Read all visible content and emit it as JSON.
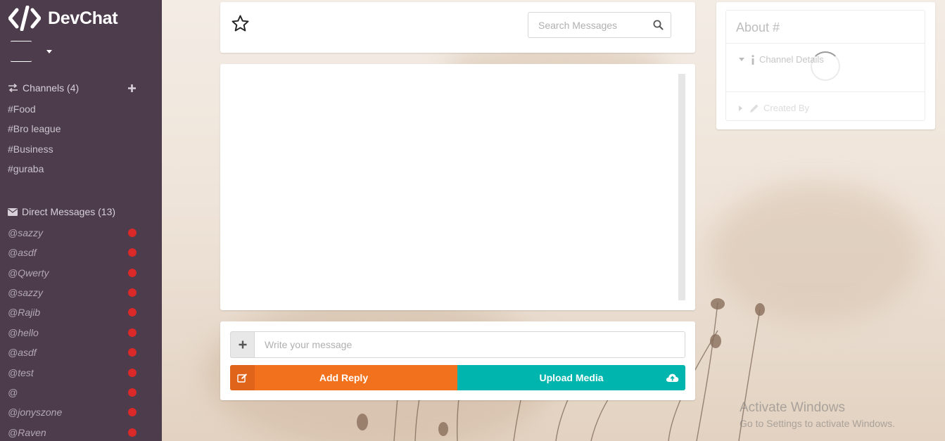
{
  "app": {
    "name": "DevChat"
  },
  "channels": {
    "header": "Channels (4)",
    "items": [
      "#Food",
      "#Bro league",
      "#Business",
      "#guraba"
    ]
  },
  "direct_messages": {
    "header": "Direct Messages (13)",
    "items": [
      "@sazzy",
      "@asdf",
      "@Qwerty",
      "@sazzy",
      "@Rajib",
      "@hello",
      "@asdf",
      "@test",
      "@",
      "@jonyszone",
      "@Raven"
    ],
    "status_color": "#db2828"
  },
  "message_header": {
    "search_placeholder": "Search Messages"
  },
  "message_form": {
    "input_placeholder": "Write your message",
    "reply_label": "Add Reply",
    "upload_label": "Upload Media",
    "reply_color": "#f2711c",
    "upload_color": "#00b5ad"
  },
  "about": {
    "title": "About #",
    "channel_details": "Channel Details",
    "created_by": "Created By"
  },
  "watermark": {
    "line1": "Activate Windows",
    "line2": "Go to Settings to activate Windows."
  },
  "colors": {
    "sidebar": "#4c3c4c"
  }
}
